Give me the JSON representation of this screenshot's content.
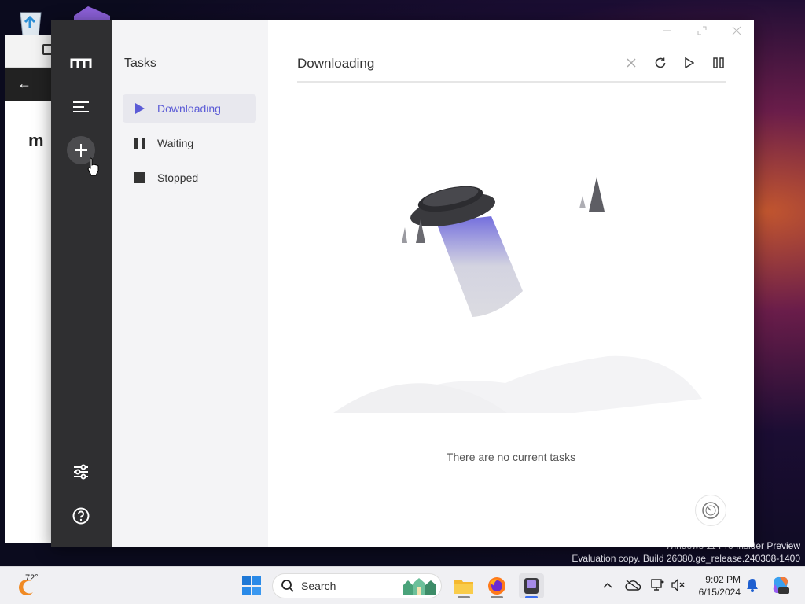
{
  "desktop": {
    "recycle_icon": "recycle-bin-icon",
    "vs_icon": "visual-studio-icon",
    "watermark_line1": "Windows 11 Pro Insider Preview",
    "watermark_line2": "Evaluation copy. Build 26080.ge_release.240308-1400"
  },
  "app": {
    "rail": {
      "logo_icon": "motrix-logo-icon",
      "menu_icon": "menu-icon",
      "add_icon": "plus-icon",
      "prefs_icon": "sliders-icon",
      "help_icon": "help-icon"
    },
    "tasks_panel": {
      "title": "Tasks",
      "items": [
        {
          "label": "Downloading",
          "icon": "play-icon",
          "active": true
        },
        {
          "label": "Waiting",
          "icon": "pause-icon",
          "active": false
        },
        {
          "label": "Stopped",
          "icon": "stop-icon",
          "active": false
        }
      ]
    },
    "main": {
      "title": "Downloading",
      "actions": [
        "close-icon",
        "refresh-icon",
        "play-icon",
        "pause-icon"
      ],
      "empty_text": "There are no current tasks",
      "speed_icon": "speedometer-icon"
    },
    "accent": "#5b5bd6"
  },
  "taskbar": {
    "weather_temp": "72°",
    "search_label": "Search",
    "time": "9:02 PM",
    "date": "6/15/2024",
    "apps": [
      "file-explorer-icon",
      "firefox-icon",
      "motrix-taskbar-icon"
    ]
  }
}
